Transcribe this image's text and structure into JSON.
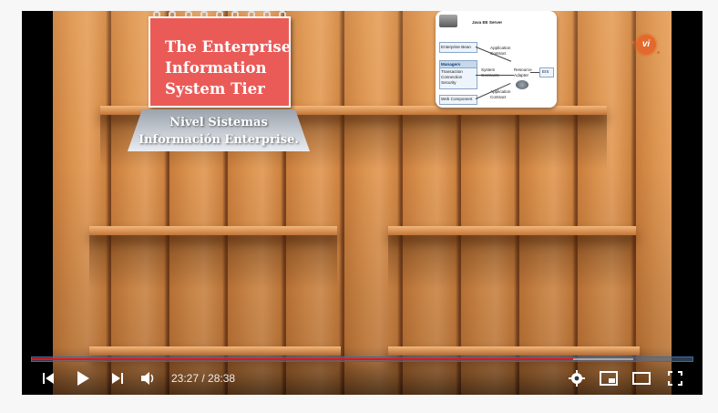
{
  "video": {
    "notepad_title_line1": "The Enterprise",
    "notepad_title_line2": "Information",
    "notepad_title_line3": "System Tier",
    "banner_line1": "Nivel Sistemas",
    "banner_line2": "Información Enterprise."
  },
  "diagram": {
    "server_label": "Java EE Server",
    "enterprise_bean": "Enterprise Bean",
    "application_contract_top": "Application Contract",
    "managers": "Managers",
    "transaction": "Transaction",
    "connection": "Connection",
    "security": "Security",
    "system_contracts": "System Contracts",
    "resource_adapter": "Resource Adapter",
    "eis": "EIS",
    "web_component": "Web Component",
    "application_contract_bottom": "Application Contract"
  },
  "logo": {
    "text": "vi"
  },
  "controls": {
    "current_time": "23:27",
    "separator": " / ",
    "duration": "28:38",
    "progress_fraction": 0.819,
    "buffered_fraction": 0.91,
    "icons": [
      "previous-icon",
      "play-icon",
      "next-icon",
      "volume-icon",
      "settings-icon",
      "miniplayer-icon",
      "theater-icon",
      "fullscreen-icon"
    ]
  }
}
